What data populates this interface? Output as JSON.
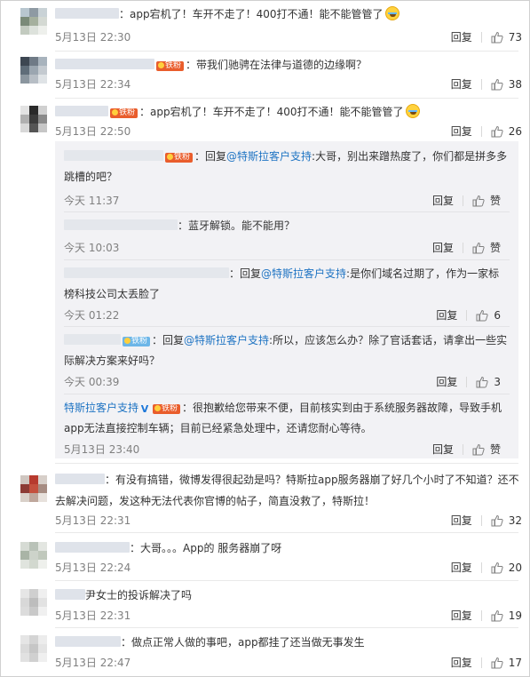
{
  "comments": [
    {
      "text": "：app宕机了！车开不走了！400打不通！能不能管管了",
      "time": "5月13日 22:30",
      "reply": "回复",
      "likes": "73"
    },
    {
      "text": "：带我们驰骋在法律与道德的边缘啊？",
      "fan_badge": "铁粉",
      "time": "5月13日 22:34",
      "reply": "回复",
      "likes": "38"
    },
    {
      "text": "：app宕机了！车开不走了！400打不通！能不能管管了",
      "fan_badge": "铁粉",
      "time": "5月13日 22:50",
      "reply": "回复",
      "likes": "26"
    },
    {
      "text": "：有没有搞错，微博发得很起劲是吗？特斯拉app服务器崩了好几个小时了不知道？还不去解决问题，发这种无法代表你官博的帖子，简直没救了，特斯拉！",
      "time": "5月13日 22:31",
      "reply": "回复",
      "likes": "32"
    },
    {
      "text": "：大哥。。。App的 服务器崩了呀",
      "time": "5月13日 22:24",
      "reply": "回复",
      "likes": "20"
    },
    {
      "text": "尹女士的投诉解决了吗",
      "time": "5月13日 22:31",
      "reply": "回复",
      "likes": "19"
    },
    {
      "text": "：做点正常人做的事吧，app都挂了还当做无事发生",
      "time": "5月13日 22:47",
      "reply": "回复",
      "likes": "17"
    }
  ],
  "replies": [
    {
      "fan_badge": "铁粉",
      "prefix": "：回复",
      "mention": "@特斯拉客户支持",
      "text": ":大哥，别出来蹭热度了，你们都是拼多多跳槽的吧？",
      "time": "今天 11:37",
      "reply": "回复",
      "like_label": "赞"
    },
    {
      "text": "：蓝牙解锁。能不能用？",
      "time": "今天 10:03",
      "reply": "回复",
      "like_label": "赞"
    },
    {
      "prefix": "：回复",
      "mention": "@特斯拉客户支持",
      "text": ":是你们域名过期了，作为一家标榜科技公司太丢脸了",
      "time": "今天 01:22",
      "reply": "回复",
      "likes": "6"
    },
    {
      "fan_badge": "铁粉",
      "prefix": "：回复",
      "mention": "@特斯拉客户支持",
      "text": ":所以，应该怎么办？除了官话套话，请拿出一些实际解决方案来好吗？",
      "time": "今天 00:39",
      "reply": "回复",
      "likes": "3"
    },
    {
      "author": "特斯拉客户支持",
      "verified": "V",
      "fan_badge": "铁粉",
      "text": "：很抱歉给您带来不便，目前核实到由于系统服务器故障，导致手机app无法直接控制车辆；目前已经紧急处理中，还请您耐心等待。",
      "time": "5月13日 23:40",
      "reply": "回复",
      "like_label": "赞"
    }
  ],
  "colors": {
    "link": "#eb7350",
    "mention": "#1f74c3",
    "reply_bg": "#f2f2f5",
    "fan_badge": "#e95d2c"
  },
  "icons": {
    "like": "thumbs-up-icon",
    "verified": "verified-v-icon",
    "emoji": "crying-laugh-emoji"
  }
}
